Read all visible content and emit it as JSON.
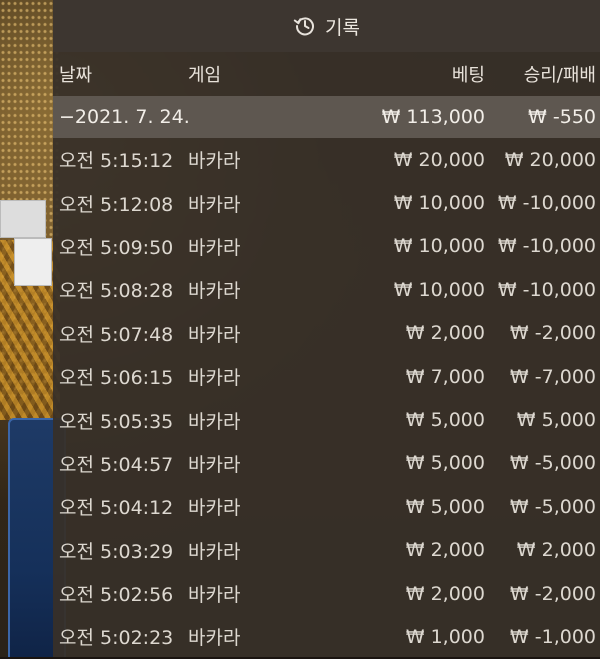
{
  "header": {
    "title": "기록",
    "icon": "history-icon"
  },
  "columns": {
    "date": "날짜",
    "game": "게임",
    "bet": "베팅",
    "result": "승리/패배"
  },
  "summary": {
    "date": "−2021. 7. 24.",
    "bet": "₩ 113,000",
    "result": "₩ -550"
  },
  "rows": [
    {
      "time": "오전 5:15:12",
      "game": "바카라",
      "bet": "₩ 20,000",
      "result": "₩ 20,000"
    },
    {
      "time": "오전 5:12:08",
      "game": "바카라",
      "bet": "₩ 10,000",
      "result": "₩ -10,000"
    },
    {
      "time": "오전 5:09:50",
      "game": "바카라",
      "bet": "₩ 10,000",
      "result": "₩ -10,000"
    },
    {
      "time": "오전 5:08:28",
      "game": "바카라",
      "bet": "₩ 10,000",
      "result": "₩ -10,000"
    },
    {
      "time": "오전 5:07:48",
      "game": "바카라",
      "bet": "₩ 2,000",
      "result": "₩ -2,000"
    },
    {
      "time": "오전 5:06:15",
      "game": "바카라",
      "bet": "₩ 7,000",
      "result": "₩ -7,000"
    },
    {
      "time": "오전 5:05:35",
      "game": "바카라",
      "bet": "₩ 5,000",
      "result": "₩ 5,000"
    },
    {
      "time": "오전 5:04:57",
      "game": "바카라",
      "bet": "₩ 5,000",
      "result": "₩ -5,000"
    },
    {
      "time": "오전 5:04:12",
      "game": "바카라",
      "bet": "₩ 5,000",
      "result": "₩ -5,000"
    },
    {
      "time": "오전 5:03:29",
      "game": "바카라",
      "bet": "₩ 2,000",
      "result": "₩ 2,000"
    },
    {
      "time": "오전 5:02:56",
      "game": "바카라",
      "bet": "₩ 2,000",
      "result": "₩ -2,000"
    },
    {
      "time": "오전 5:02:23",
      "game": "바카라",
      "bet": "₩ 1,000",
      "result": "₩ -1,000"
    }
  ]
}
